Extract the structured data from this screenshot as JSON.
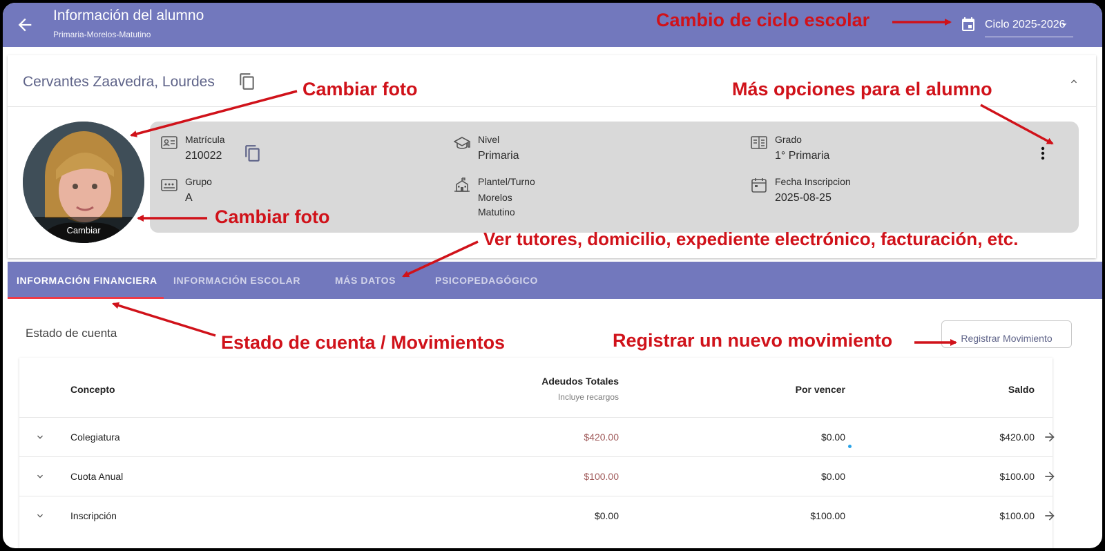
{
  "header": {
    "title": "Información del alumno",
    "subtitle": "Primaria-Morelos-Matutino",
    "cycle": "Ciclo 2025-2026"
  },
  "student": {
    "name": "Cervantes Zaavedra, Lourdes",
    "photo_change_label": "Cambiar",
    "fields": {
      "matricula": {
        "label": "Matrícula",
        "value": "210022"
      },
      "nivel": {
        "label": "Nivel",
        "value": "Primaria"
      },
      "grado": {
        "label": "Grado",
        "value": "1° Primaria"
      },
      "grupo": {
        "label": "Grupo",
        "value": "A"
      },
      "plantel": {
        "label": "Plantel/Turno",
        "value": "Morelos",
        "value2": "Matutino"
      },
      "fecha": {
        "label": "Fecha Inscripcion",
        "value": "2025-08-25"
      }
    }
  },
  "tabs": [
    {
      "label": "INFORMACIÓN FINANCIERA"
    },
    {
      "label": "INFORMACIÓN ESCOLAR"
    },
    {
      "label": "MÁS DATOS"
    },
    {
      "label": "PSICOPEDAGÓGICO"
    }
  ],
  "account": {
    "title": "Estado de cuenta",
    "register_button": "Registrar Movimiento",
    "columns": {
      "concepto": "Concepto",
      "adeudos": "Adeudos Totales",
      "adeudos_sub": "Incluye recargos",
      "por_vencer": "Por vencer",
      "saldo": "Saldo"
    },
    "rows": [
      {
        "concepto": "Colegiatura",
        "adeudos": "$420.00",
        "por_vencer": "$0.00",
        "saldo": "$420.00"
      },
      {
        "concepto": "Cuota Anual",
        "adeudos": "$100.00",
        "por_vencer": "$0.00",
        "saldo": "$100.00"
      },
      {
        "concepto": "Inscripción",
        "adeudos": "$0.00",
        "por_vencer": "$100.00",
        "saldo": "$100.00"
      }
    ]
  },
  "annotations": {
    "ciclo": "Cambio de ciclo escolar",
    "foto_top": "Cambiar foto",
    "opciones": "Más opciones para el alumno",
    "foto_bottom": "Cambiar foto",
    "ver_tutores": "Ver tutores, domicilio, expediente electrónico, facturación, etc.",
    "estado": "Estado de cuenta / Movimientos",
    "registrar": "Registrar un nuevo movimiento"
  },
  "colors": {
    "primary": "#7278bd",
    "annotation": "#d0121a",
    "tab_indicator": "#ee3b47",
    "debt": "#a05a5a"
  },
  "icons": [
    "back-arrow-icon",
    "calendar-icon",
    "caret-down-icon",
    "copy-icon",
    "chevron-up-icon",
    "id-card-icon",
    "graduation-cap-icon",
    "grade-icon",
    "group-icon",
    "school-building-icon",
    "calendar-icon",
    "more-vert-icon",
    "chevron-down-icon",
    "arrow-right-icon"
  ]
}
